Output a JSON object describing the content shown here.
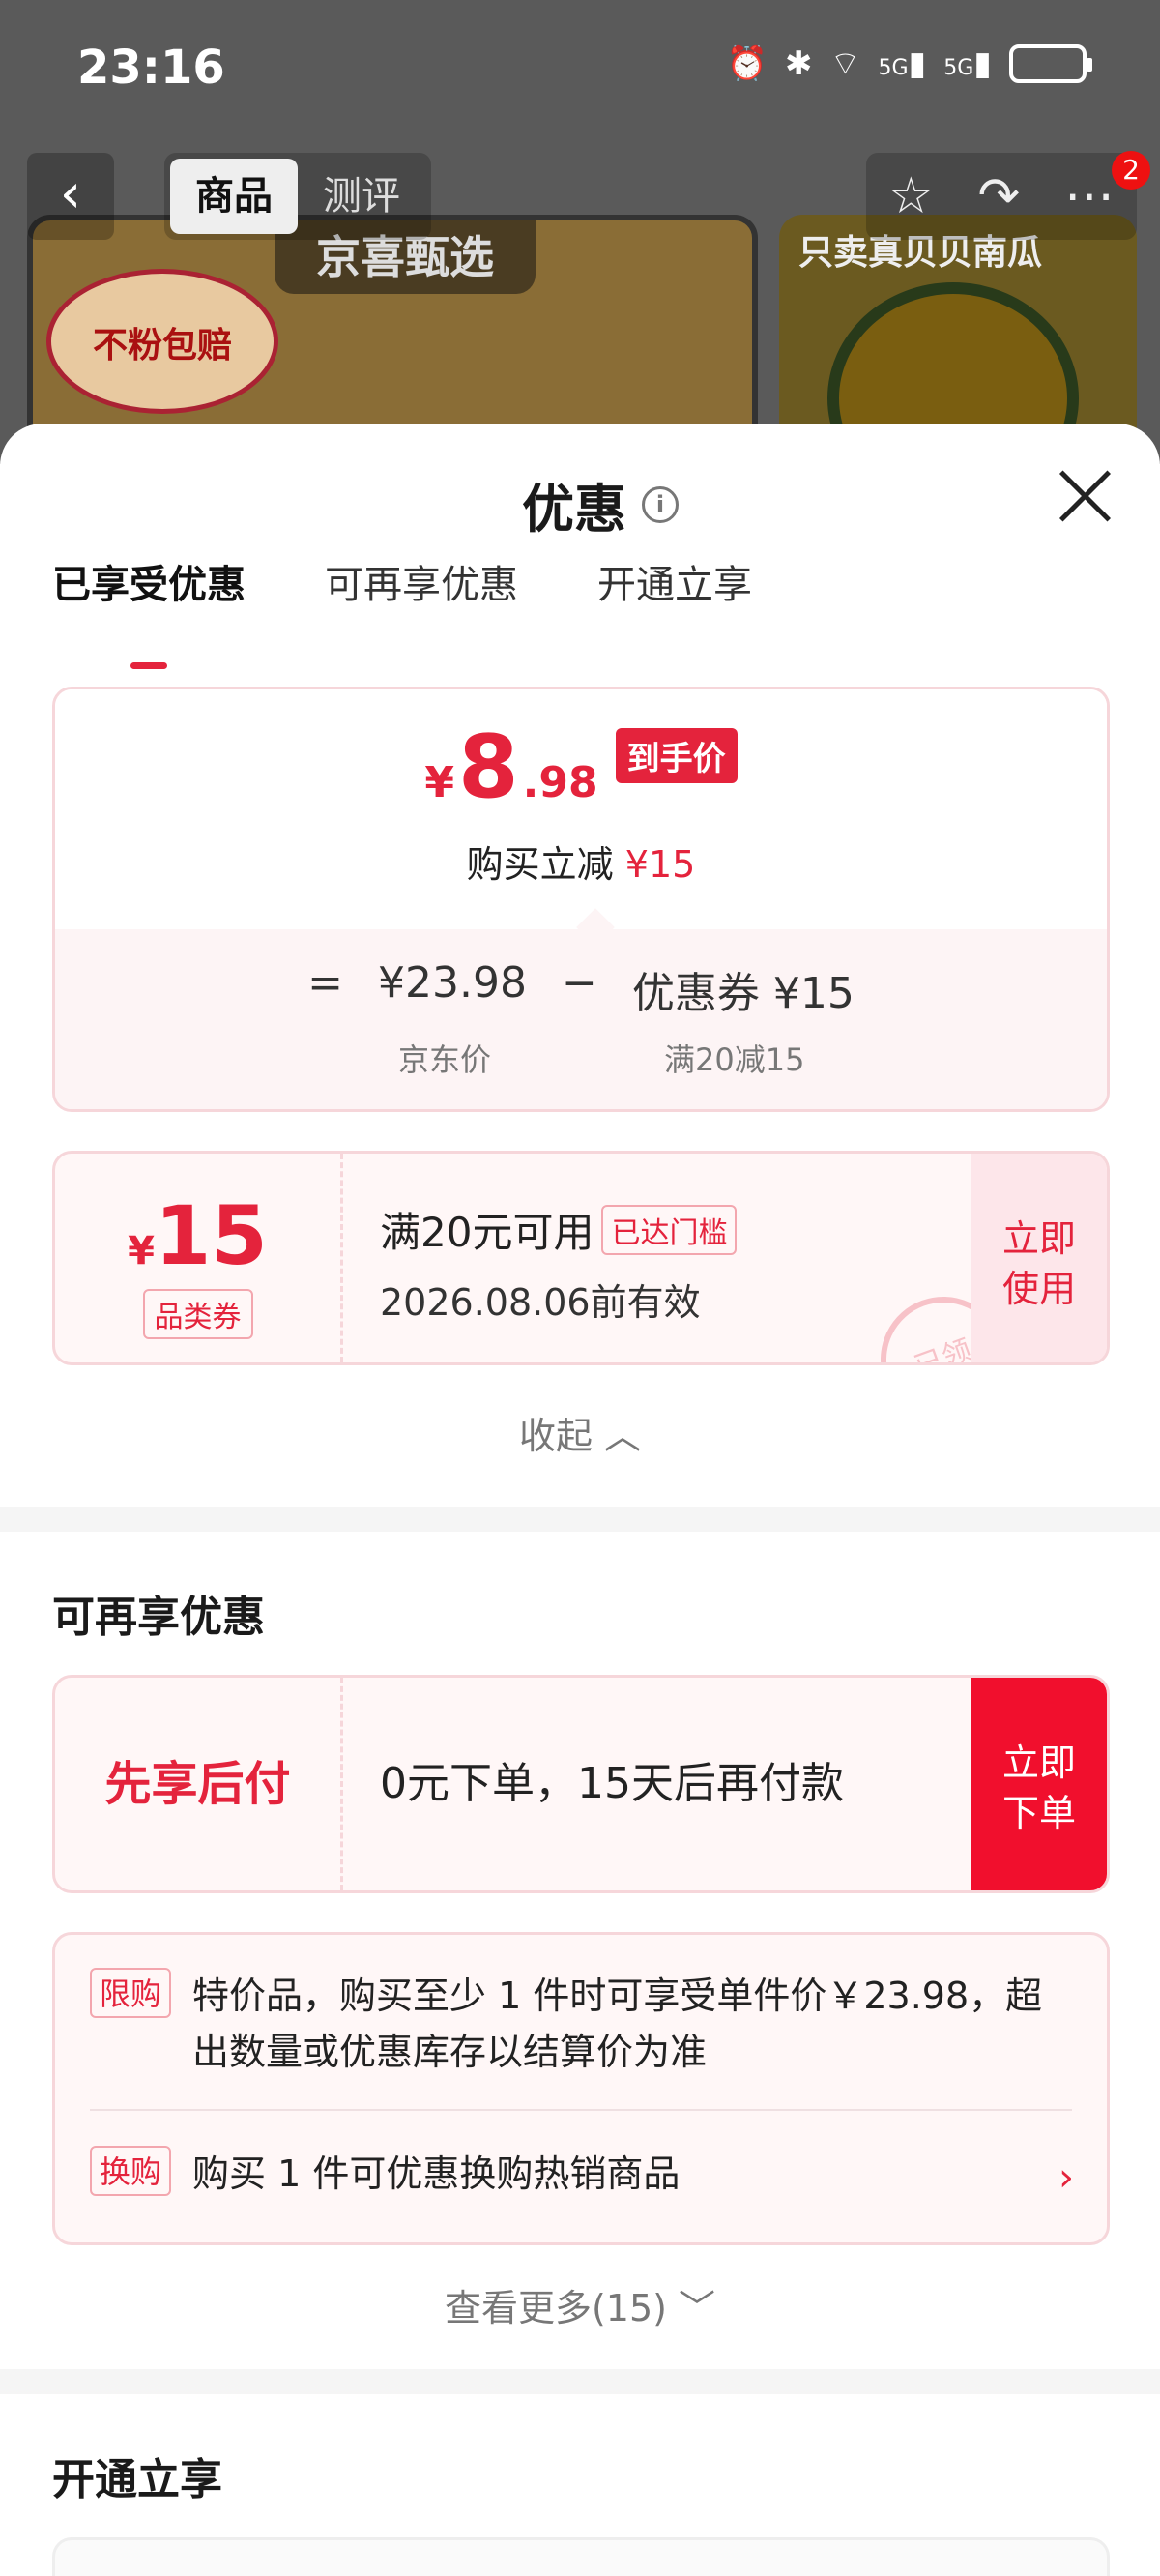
{
  "status_bar": {
    "time": "23:16",
    "icons": [
      "alarm-icon",
      "bluetooth-icon",
      "wifi-icon",
      "signal-5g-icon",
      "signal-5g-icon",
      "battery-icon"
    ],
    "net1": "5G",
    "net2": "5G"
  },
  "background": {
    "tabs": [
      "商品",
      "测评"
    ],
    "badge": "2",
    "banner": "京喜甄选",
    "seal": "不粉包赔",
    "right_text": "只卖真贝贝南瓜"
  },
  "sheet": {
    "title": "优惠",
    "tabs": [
      "已享受优惠",
      "可再享优惠",
      "开通立享"
    ],
    "price": {
      "yen": "¥",
      "int": "8",
      "dec": ".98",
      "tag": "到手价",
      "sub_label": "购买立减",
      "sub_value": "¥15",
      "eq": "=",
      "jd_price": "¥23.98",
      "minus": "−",
      "coupon_formula": "优惠券 ¥15",
      "jd_label": "京东价",
      "coupon_label": "满20减15"
    },
    "coupon": {
      "yen": "¥",
      "amount": "15",
      "type": "品类券",
      "condition": "满20元可用",
      "reached": "已达门槛",
      "valid": "2026.08.06前有效",
      "stamp": "已领",
      "use_line1": "立即",
      "use_line2": "使用"
    },
    "collapse": "收起",
    "more_section": {
      "title": "可再享优惠",
      "bnpl_label": "先享后付",
      "bnpl_text": "0元下单，15天后再付款",
      "bnpl_btn_line1": "立即",
      "bnpl_btn_line2": "下单",
      "limit_tag": "限购",
      "limit_text": "特价品，购买至少 1 件时可享受单件价￥23.98，超出数量或优惠库存以结算价为准",
      "swap_tag": "换购",
      "swap_text": "购买 1 件可优惠换购热销商品",
      "see_more": "查看更多(15)"
    },
    "open_section": {
      "title": "开通立享"
    }
  },
  "colors": {
    "accent": "#e4233c",
    "border": "#f6d6da",
    "tint": "#fff7f7"
  }
}
